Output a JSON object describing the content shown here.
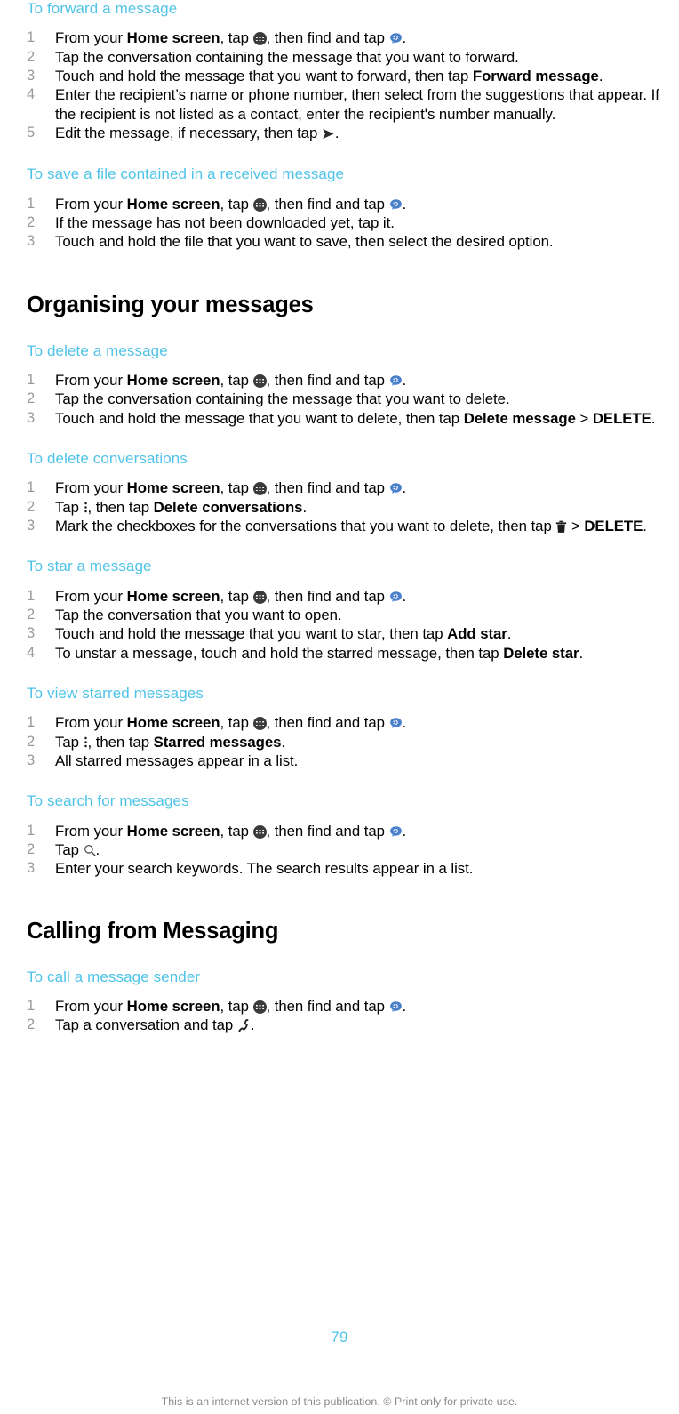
{
  "document": {
    "page_number": "79",
    "footer_note": "This is an internet version of this publication. © Print only for private use.",
    "accent_color": "#4FC3E8",
    "number_color": "#9A9A9A",
    "body_color": "#000000"
  },
  "icons": {
    "app_drawer": "app-drawer-icon",
    "messaging": "messaging-icon",
    "send": "send-icon",
    "overflow": "overflow-menu-icon",
    "trash": "trash-icon",
    "search": "search-icon",
    "phone": "phone-icon"
  },
  "procedures": [
    {
      "id": "forward-a-message",
      "title": "To forward a message",
      "steps": [
        {
          "parts": [
            {
              "t": "text",
              "v": "From your "
            },
            {
              "t": "bold",
              "v": "Home screen"
            },
            {
              "t": "text",
              "v": ", tap "
            },
            {
              "t": "icon",
              "v": "app-drawer-icon"
            },
            {
              "t": "text",
              "v": ", then find and tap "
            },
            {
              "t": "icon",
              "v": "messaging-icon"
            },
            {
              "t": "text",
              "v": "."
            }
          ]
        },
        {
          "parts": [
            {
              "t": "text",
              "v": "Tap the conversation containing the message that you want to forward."
            }
          ]
        },
        {
          "parts": [
            {
              "t": "text",
              "v": "Touch and hold the message that you want to forward, then tap "
            },
            {
              "t": "bold",
              "v": "Forward message"
            },
            {
              "t": "text",
              "v": "."
            }
          ]
        },
        {
          "parts": [
            {
              "t": "text",
              "v": "Enter the recipient’s name or phone number, then select from the suggestions that appear. If the recipient is not listed as a contact, enter the recipient's number manually."
            }
          ]
        },
        {
          "parts": [
            {
              "t": "text",
              "v": "Edit the message, if necessary, then tap "
            },
            {
              "t": "icon",
              "v": "send-icon"
            },
            {
              "t": "text",
              "v": "."
            }
          ]
        }
      ]
    },
    {
      "id": "save-a-file-contained-in-a-received-message",
      "title": "To save a file contained in a received message",
      "steps": [
        {
          "parts": [
            {
              "t": "text",
              "v": "From your "
            },
            {
              "t": "bold",
              "v": "Home screen"
            },
            {
              "t": "text",
              "v": ", tap "
            },
            {
              "t": "icon",
              "v": "app-drawer-icon"
            },
            {
              "t": "text",
              "v": ", then find and tap "
            },
            {
              "t": "icon",
              "v": "messaging-icon"
            },
            {
              "t": "text",
              "v": "."
            }
          ]
        },
        {
          "parts": [
            {
              "t": "text",
              "v": "If the message has not been downloaded yet, tap it."
            }
          ]
        },
        {
          "parts": [
            {
              "t": "text",
              "v": "Touch and hold the file that you want to save, then select the desired option."
            }
          ]
        }
      ]
    }
  ],
  "section_organising": {
    "heading": "Organising your messages",
    "procedures": [
      {
        "id": "delete-a-message",
        "title": "To delete a message",
        "steps": [
          {
            "parts": [
              {
                "t": "text",
                "v": "From your "
              },
              {
                "t": "bold",
                "v": "Home screen"
              },
              {
                "t": "text",
                "v": ", tap "
              },
              {
                "t": "icon",
                "v": "app-drawer-icon"
              },
              {
                "t": "text",
                "v": ", then find and tap "
              },
              {
                "t": "icon",
                "v": "messaging-icon"
              },
              {
                "t": "text",
                "v": "."
              }
            ]
          },
          {
            "parts": [
              {
                "t": "text",
                "v": "Tap the conversation containing the message that you want to delete."
              }
            ]
          },
          {
            "parts": [
              {
                "t": "text",
                "v": "Touch and hold the message that you want to delete, then tap "
              },
              {
                "t": "bold",
                "v": "Delete message"
              },
              {
                "t": "text",
                "v": " > "
              },
              {
                "t": "bold",
                "v": "DELETE"
              },
              {
                "t": "text",
                "v": "."
              }
            ]
          }
        ]
      },
      {
        "id": "delete-conversations",
        "title": "To delete conversations",
        "steps": [
          {
            "parts": [
              {
                "t": "text",
                "v": "From your "
              },
              {
                "t": "bold",
                "v": "Home screen"
              },
              {
                "t": "text",
                "v": ", tap "
              },
              {
                "t": "icon",
                "v": "app-drawer-icon"
              },
              {
                "t": "text",
                "v": ", then find and tap "
              },
              {
                "t": "icon",
                "v": "messaging-icon"
              },
              {
                "t": "text",
                "v": "."
              }
            ]
          },
          {
            "parts": [
              {
                "t": "text",
                "v": "Tap "
              },
              {
                "t": "icon",
                "v": "overflow-menu-icon"
              },
              {
                "t": "text",
                "v": ", then tap "
              },
              {
                "t": "bold",
                "v": "Delete conversations"
              },
              {
                "t": "text",
                "v": "."
              }
            ]
          },
          {
            "parts": [
              {
                "t": "text",
                "v": "Mark the checkboxes for the conversations that you want to delete, then tap "
              },
              {
                "t": "icon",
                "v": "trash-icon"
              },
              {
                "t": "text",
                "v": " > "
              },
              {
                "t": "bold",
                "v": "DELETE"
              },
              {
                "t": "text",
                "v": "."
              }
            ]
          }
        ]
      },
      {
        "id": "star-a-message",
        "title": "To star a message",
        "steps": [
          {
            "parts": [
              {
                "t": "text",
                "v": "From your "
              },
              {
                "t": "bold",
                "v": "Home screen"
              },
              {
                "t": "text",
                "v": ", tap "
              },
              {
                "t": "icon",
                "v": "app-drawer-icon"
              },
              {
                "t": "text",
                "v": ", then find and tap "
              },
              {
                "t": "icon",
                "v": "messaging-icon"
              },
              {
                "t": "text",
                "v": "."
              }
            ]
          },
          {
            "parts": [
              {
                "t": "text",
                "v": "Tap the conversation that you want to open."
              }
            ]
          },
          {
            "parts": [
              {
                "t": "text",
                "v": "Touch and hold the message that you want to star, then tap "
              },
              {
                "t": "bold",
                "v": "Add star"
              },
              {
                "t": "text",
                "v": "."
              }
            ]
          },
          {
            "parts": [
              {
                "t": "text",
                "v": "To unstar a message, touch and hold the starred message, then tap "
              },
              {
                "t": "bold",
                "v": "Delete star"
              },
              {
                "t": "text",
                "v": "."
              }
            ]
          }
        ]
      },
      {
        "id": "view-starred-messages",
        "title": "To view starred messages",
        "steps": [
          {
            "parts": [
              {
                "t": "text",
                "v": "From your "
              },
              {
                "t": "bold",
                "v": "Home screen"
              },
              {
                "t": "text",
                "v": ", tap "
              },
              {
                "t": "icon",
                "v": "app-drawer-icon"
              },
              {
                "t": "text",
                "v": ", then find and tap "
              },
              {
                "t": "icon",
                "v": "messaging-icon"
              },
              {
                "t": "text",
                "v": "."
              }
            ]
          },
          {
            "parts": [
              {
                "t": "text",
                "v": "Tap "
              },
              {
                "t": "icon",
                "v": "overflow-menu-icon"
              },
              {
                "t": "text",
                "v": ", then tap "
              },
              {
                "t": "bold",
                "v": "Starred messages"
              },
              {
                "t": "text",
                "v": "."
              }
            ]
          },
          {
            "parts": [
              {
                "t": "text",
                "v": "All starred messages appear in a list."
              }
            ]
          }
        ]
      },
      {
        "id": "search-for-messages",
        "title": "To search for messages",
        "steps": [
          {
            "parts": [
              {
                "t": "text",
                "v": "From your "
              },
              {
                "t": "bold",
                "v": "Home screen"
              },
              {
                "t": "text",
                "v": ", tap "
              },
              {
                "t": "icon",
                "v": "app-drawer-icon"
              },
              {
                "t": "text",
                "v": ", then find and tap "
              },
              {
                "t": "icon",
                "v": "messaging-icon"
              },
              {
                "t": "text",
                "v": "."
              }
            ]
          },
          {
            "parts": [
              {
                "t": "text",
                "v": "Tap "
              },
              {
                "t": "icon",
                "v": "search-icon"
              },
              {
                "t": "text",
                "v": "."
              }
            ]
          },
          {
            "parts": [
              {
                "t": "text",
                "v": "Enter your search keywords. The search results appear in a list."
              }
            ]
          }
        ]
      }
    ]
  },
  "section_calling": {
    "heading": "Calling from Messaging",
    "procedures": [
      {
        "id": "call-a-message-sender",
        "title": "To call a message sender",
        "steps": [
          {
            "parts": [
              {
                "t": "text",
                "v": "From your "
              },
              {
                "t": "bold",
                "v": "Home screen"
              },
              {
                "t": "text",
                "v": ", tap "
              },
              {
                "t": "icon",
                "v": "app-drawer-icon"
              },
              {
                "t": "text",
                "v": ", then find and tap "
              },
              {
                "t": "icon",
                "v": "messaging-icon"
              },
              {
                "t": "text",
                "v": "."
              }
            ]
          },
          {
            "parts": [
              {
                "t": "text",
                "v": "Tap a conversation and tap "
              },
              {
                "t": "icon",
                "v": "phone-icon"
              },
              {
                "t": "text",
                "v": "."
              }
            ]
          }
        ]
      }
    ]
  }
}
